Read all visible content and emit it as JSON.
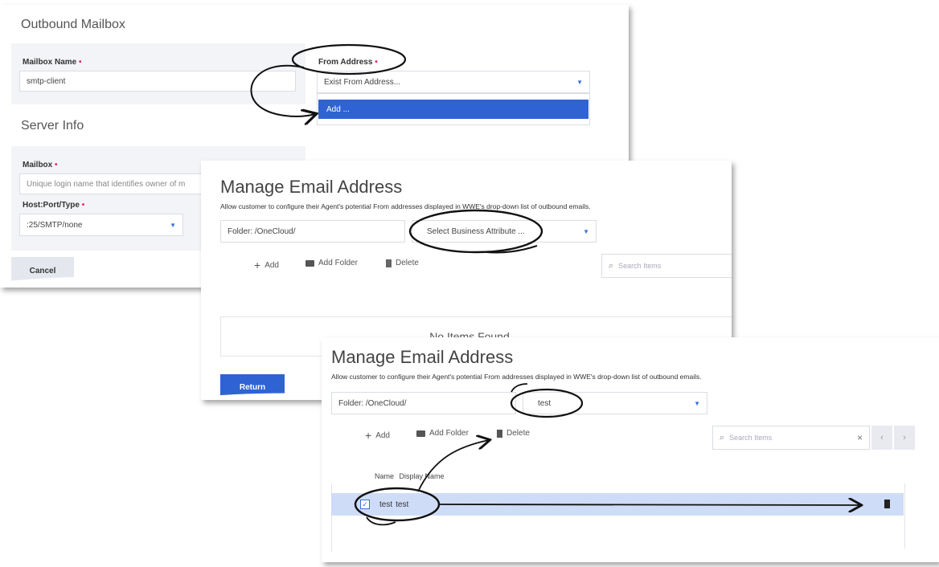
{
  "panel1": {
    "title": "Outbound Mailbox",
    "mailbox_name_label": "Mailbox Name",
    "mailbox_name_value": "smtp-client",
    "from_address_label": "From Address",
    "from_address_value": "Exist From Address...",
    "dropdown_option_add": "Add ...",
    "server_info_title": "Server Info",
    "mailbox_label": "Mailbox",
    "mailbox_placeholder": "Unique login name that identifies owner of m",
    "host_port_type_label": "Host:Port/Type",
    "host_port_type_value": ":25/SMTP/none",
    "cancel_label": "Cancel",
    "required_mark": "•"
  },
  "panel2": {
    "title": "Manage Email Address",
    "description": "Allow customer to configure their Agent's potential From addresses displayed in WWE's drop-down list of outbound emails.",
    "folder_value": "Folder: /OneCloud/",
    "business_attribute_value": "Select Business Attribute ...",
    "add_label": "Add",
    "add_folder_label": "Add Folder",
    "delete_label": "Delete",
    "search_placeholder": "Search Items",
    "empty_message": "No Items Found",
    "return_label": "Return"
  },
  "panel3": {
    "title": "Manage Email Address",
    "description": "Allow customer to configure their Agent's potential From addresses displayed in WWE's drop-down list of outbound emails.",
    "folder_value": "Folder: /OneCloud/",
    "business_attribute_value": "test",
    "add_label": "Add",
    "add_folder_label": "Add Folder",
    "delete_label": "Delete",
    "search_placeholder": "Search Items",
    "clear_symbol": "×",
    "prev_symbol": "‹",
    "next_symbol": "›",
    "column_headers": [
      "Name",
      "Display Name"
    ],
    "rows": [
      {
        "name": "test",
        "display_name": "test"
      }
    ]
  },
  "colors": {
    "accent": "#3b6fd6",
    "selected_row": "#cfdcf7",
    "required": "#e0245e",
    "button_primary": "#2f63d3"
  },
  "icons": [
    "plus-icon",
    "folder-icon",
    "trash-icon",
    "search-icon",
    "chevron-down-icon",
    "checkbox-icon",
    "trash-row-icon"
  ]
}
